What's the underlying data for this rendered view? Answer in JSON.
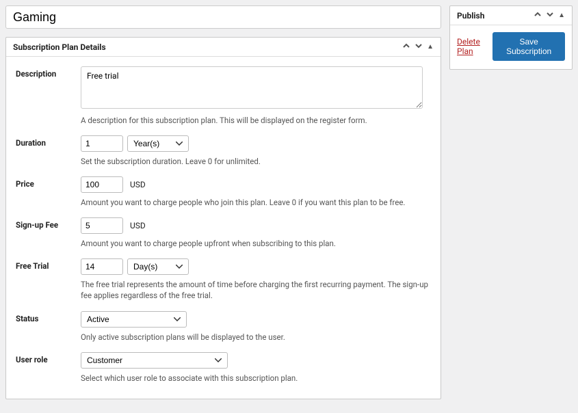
{
  "title": "Gaming",
  "panel_heading": "Subscription Plan Details",
  "fields": {
    "description": {
      "label": "Description",
      "value": "Free trial",
      "help": "A description for this subscription plan. This will be displayed on the register form."
    },
    "duration": {
      "label": "Duration",
      "value": "1",
      "unit": "Year(s)",
      "help": "Set the subscription duration. Leave 0 for unlimited."
    },
    "price": {
      "label": "Price",
      "value": "100",
      "currency": "USD",
      "help": "Amount you want to charge people who join this plan. Leave 0 if you want this plan to be free."
    },
    "signup_fee": {
      "label": "Sign-up Fee",
      "value": "5",
      "currency": "USD",
      "help": "Amount you want to charge people upfront when subscribing to this plan."
    },
    "free_trial": {
      "label": "Free Trial",
      "value": "14",
      "unit": "Day(s)",
      "help": "The free trial represents the amount of time before charging the first recurring payment. The sign-up fee applies regardless of the free trial."
    },
    "status": {
      "label": "Status",
      "value": "Active",
      "help": "Only active subscription plans will be displayed to the user."
    },
    "user_role": {
      "label": "User role",
      "value": "Customer",
      "help": "Select which user role to associate with this subscription plan."
    }
  },
  "publish": {
    "heading": "Publish",
    "delete_label": "Delete Plan",
    "save_label": "Save Subscription"
  }
}
